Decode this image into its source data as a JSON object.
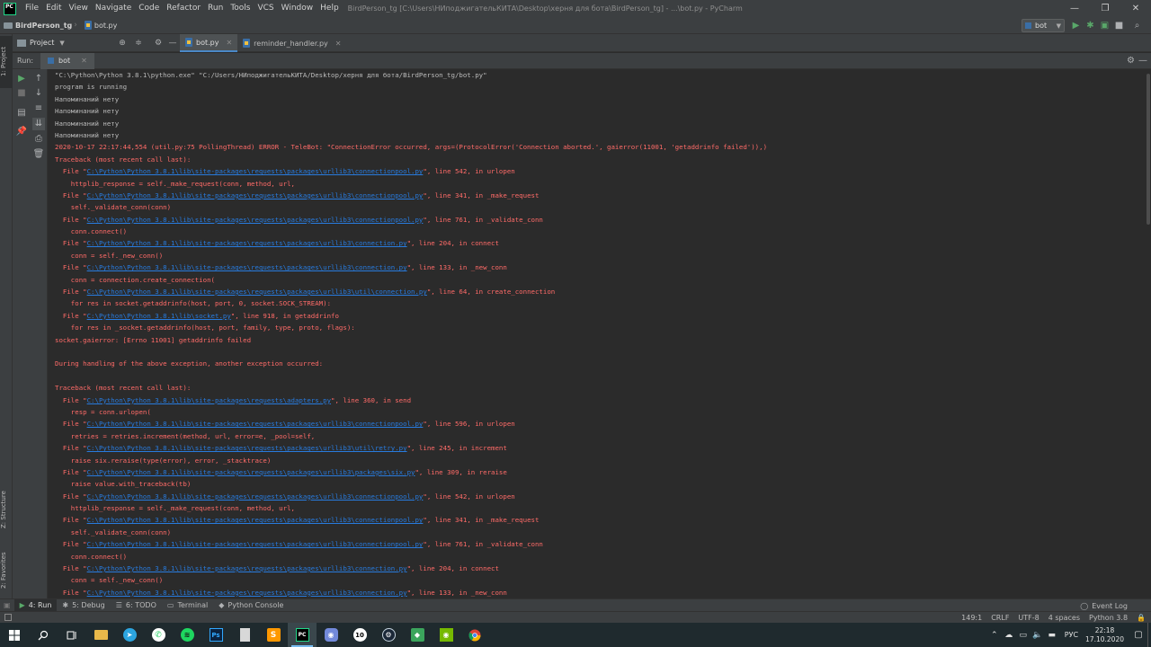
{
  "titlebar": {
    "menu": [
      "File",
      "Edit",
      "View",
      "Navigate",
      "Code",
      "Refactor",
      "Run",
      "Tools",
      "VCS",
      "Window",
      "Help"
    ],
    "window_title": "BirdPerson_tg [C:\\Users\\НИподжигательКИТА\\Desktop\\херня для бота\\BirdPerson_tg] - ...\\bot.py - PyCharm",
    "minimize": "—",
    "maximize": "❐",
    "close": "✕"
  },
  "navbar": {
    "project": "BirdPerson_tg",
    "file": "bot.py",
    "run_config": "bot"
  },
  "tool_stripe": {
    "project_tab": "1: Project",
    "structure_tab": "Z: Structure",
    "favorites_tab": "2: Favorites"
  },
  "project_header": {
    "label": "Project"
  },
  "editor_tabs": [
    {
      "label": "bot.py",
      "active": true
    },
    {
      "label": "reminder_handler.py",
      "active": false
    }
  ],
  "run_panel": {
    "title": "Run:",
    "tab_label": "bot"
  },
  "console": {
    "lines": [
      {
        "kind": "norm",
        "text": "\"C:\\Python\\Python 3.8.1\\python.exe\" \"C:/Users/НИподжигательКИТА/Desktop/херня для бота/BirdPerson_tg/bot.py\""
      },
      {
        "kind": "norm",
        "text": "program is running"
      },
      {
        "kind": "norm",
        "text": "Напоминаний нету"
      },
      {
        "kind": "norm",
        "text": "Напоминаний нету"
      },
      {
        "kind": "norm",
        "text": "Напоминаний нету"
      },
      {
        "kind": "norm",
        "text": "Напоминаний нету"
      },
      {
        "kind": "err",
        "text": "2020-10-17 22:17:44,554 (util.py:75 PollingThread) ERROR - TeleBot: \"ConnectionError occurred, args=(ProtocolError('Connection aborted.', gaierror(11001, 'getaddrinfo failed')),)"
      },
      {
        "kind": "err",
        "text": "Traceback (most recent call last):"
      },
      {
        "kind": "file",
        "pre": "  File \"",
        "link": "C:\\Python\\Python 3.8.1\\lib\\site-packages\\requests\\packages\\urllib3\\connectionpool.py",
        "post": "\", line 542, in urlopen"
      },
      {
        "kind": "err",
        "text": "    httplib_response = self._make_request(conn, method, url,"
      },
      {
        "kind": "file",
        "pre": "  File \"",
        "link": "C:\\Python\\Python 3.8.1\\lib\\site-packages\\requests\\packages\\urllib3\\connectionpool.py",
        "post": "\", line 341, in _make_request"
      },
      {
        "kind": "err",
        "text": "    self._validate_conn(conn)"
      },
      {
        "kind": "file",
        "pre": "  File \"",
        "link": "C:\\Python\\Python 3.8.1\\lib\\site-packages\\requests\\packages\\urllib3\\connectionpool.py",
        "post": "\", line 761, in _validate_conn"
      },
      {
        "kind": "err",
        "text": "    conn.connect()"
      },
      {
        "kind": "file",
        "pre": "  File \"",
        "link": "C:\\Python\\Python 3.8.1\\lib\\site-packages\\requests\\packages\\urllib3\\connection.py",
        "post": "\", line 204, in connect"
      },
      {
        "kind": "err",
        "text": "    conn = self._new_conn()"
      },
      {
        "kind": "file",
        "pre": "  File \"",
        "link": "C:\\Python\\Python 3.8.1\\lib\\site-packages\\requests\\packages\\urllib3\\connection.py",
        "post": "\", line 133, in _new_conn"
      },
      {
        "kind": "err",
        "text": "    conn = connection.create_connection("
      },
      {
        "kind": "file",
        "pre": "  File \"",
        "link": "C:\\Python\\Python 3.8.1\\lib\\site-packages\\requests\\packages\\urllib3\\util\\connection.py",
        "post": "\", line 64, in create_connection"
      },
      {
        "kind": "err",
        "text": "    for res in socket.getaddrinfo(host, port, 0, socket.SOCK_STREAM):"
      },
      {
        "kind": "file",
        "pre": "  File \"",
        "link": "C:\\Python\\Python 3.8.1\\lib\\socket.py",
        "post": "\", line 918, in getaddrinfo"
      },
      {
        "kind": "err",
        "text": "    for res in _socket.getaddrinfo(host, port, family, type, proto, flags):"
      },
      {
        "kind": "err",
        "text": "socket.gaierror: [Errno 11001] getaddrinfo failed"
      },
      {
        "kind": "err",
        "text": ""
      },
      {
        "kind": "err",
        "text": "During handling of the above exception, another exception occurred:"
      },
      {
        "kind": "err",
        "text": ""
      },
      {
        "kind": "err",
        "text": "Traceback (most recent call last):"
      },
      {
        "kind": "file",
        "pre": "  File \"",
        "link": "C:\\Python\\Python 3.8.1\\lib\\site-packages\\requests\\adapters.py",
        "post": "\", line 360, in send"
      },
      {
        "kind": "err",
        "text": "    resp = conn.urlopen("
      },
      {
        "kind": "file",
        "pre": "  File \"",
        "link": "C:\\Python\\Python 3.8.1\\lib\\site-packages\\requests\\packages\\urllib3\\connectionpool.py",
        "post": "\", line 596, in urlopen"
      },
      {
        "kind": "err",
        "text": "    retries = retries.increment(method, url, error=e, _pool=self,"
      },
      {
        "kind": "file",
        "pre": "  File \"",
        "link": "C:\\Python\\Python 3.8.1\\lib\\site-packages\\requests\\packages\\urllib3\\util\\retry.py",
        "post": "\", line 245, in increment"
      },
      {
        "kind": "err",
        "text": "    raise six.reraise(type(error), error, _stacktrace)"
      },
      {
        "kind": "file",
        "pre": "  File \"",
        "link": "C:\\Python\\Python 3.8.1\\lib\\site-packages\\requests\\packages\\urllib3\\packages\\six.py",
        "post": "\", line 309, in reraise"
      },
      {
        "kind": "err",
        "text": "    raise value.with_traceback(tb)"
      },
      {
        "kind": "file",
        "pre": "  File \"",
        "link": "C:\\Python\\Python 3.8.1\\lib\\site-packages\\requests\\packages\\urllib3\\connectionpool.py",
        "post": "\", line 542, in urlopen"
      },
      {
        "kind": "err",
        "text": "    httplib_response = self._make_request(conn, method, url,"
      },
      {
        "kind": "file",
        "pre": "  File \"",
        "link": "C:\\Python\\Python 3.8.1\\lib\\site-packages\\requests\\packages\\urllib3\\connectionpool.py",
        "post": "\", line 341, in _make_request"
      },
      {
        "kind": "err",
        "text": "    self._validate_conn(conn)"
      },
      {
        "kind": "file",
        "pre": "  File \"",
        "link": "C:\\Python\\Python 3.8.1\\lib\\site-packages\\requests\\packages\\urllib3\\connectionpool.py",
        "post": "\", line 761, in _validate_conn"
      },
      {
        "kind": "err",
        "text": "    conn.connect()"
      },
      {
        "kind": "file",
        "pre": "  File \"",
        "link": "C:\\Python\\Python 3.8.1\\lib\\site-packages\\requests\\packages\\urllib3\\connection.py",
        "post": "\", line 204, in connect"
      },
      {
        "kind": "err",
        "text": "    conn = self._new_conn()"
      },
      {
        "kind": "file",
        "pre": "  File \"",
        "link": "C:\\Python\\Python 3.8.1\\lib\\site-packages\\requests\\packages\\urllib3\\connection.py",
        "post": "\", line 133, in _new_conn"
      }
    ]
  },
  "toolwindows": {
    "run": "4: Run",
    "debug": "5: Debug",
    "todo": "6: TODO",
    "terminal": "Terminal",
    "python_console": "Python Console",
    "event_log": "Event Log"
  },
  "status": {
    "position": "149:1",
    "line_sep": "CRLF",
    "encoding": "UTF-8",
    "indent": "4 spaces",
    "interpreter": "Python 3.8"
  },
  "taskbar": {
    "lang": "РУС",
    "time": "22:18",
    "date": "17.10.2020"
  },
  "colors": {
    "error_text": "#ff6b68",
    "link": "#287bde",
    "normal_text": "#bbbbbb",
    "run_green": "#59a869"
  }
}
